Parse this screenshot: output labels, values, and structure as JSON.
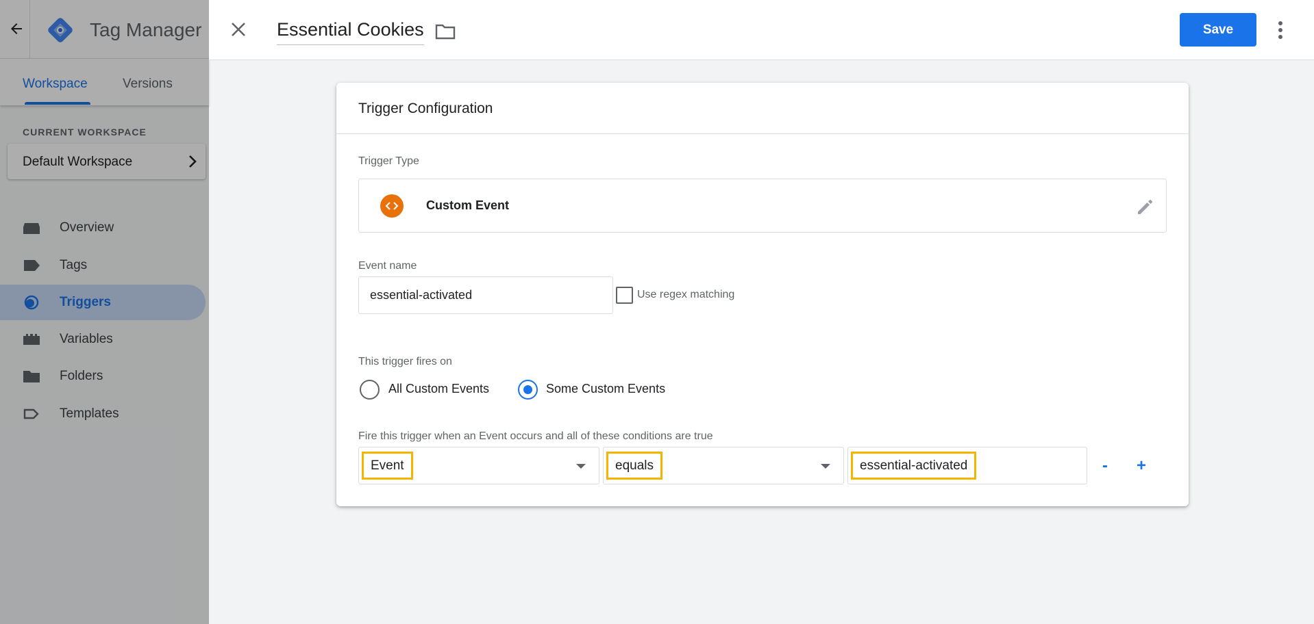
{
  "app": {
    "title": "Tag Manager",
    "brand_color": "#1a73e8",
    "icons": {
      "back": "arrow-left-icon",
      "logo": "tag-manager-logo"
    }
  },
  "workspace_tabs": [
    {
      "label": "Workspace",
      "active": true
    },
    {
      "label": "Versions",
      "active": false
    }
  ],
  "current_workspace": {
    "heading": "CURRENT WORKSPACE",
    "name": "Default Workspace"
  },
  "sidebar": {
    "items": [
      {
        "label": "Overview",
        "icon": "overview-icon",
        "active": false
      },
      {
        "label": "Tags",
        "icon": "tag-icon",
        "active": false
      },
      {
        "label": "Triggers",
        "icon": "trigger-icon",
        "active": true
      },
      {
        "label": "Variables",
        "icon": "variables-icon",
        "active": false
      },
      {
        "label": "Folders",
        "icon": "folder-icon",
        "active": false
      },
      {
        "label": "Templates",
        "icon": "template-icon",
        "active": false
      }
    ]
  },
  "editor": {
    "trigger_name": "Essential Cookies",
    "save_label": "Save",
    "icons": {
      "close": "close-icon",
      "folder": "folder-icon",
      "more": "more-vert-icon"
    }
  },
  "config": {
    "title": "Trigger Configuration",
    "trigger_type_label": "Trigger Type",
    "trigger_type": "Custom Event",
    "trigger_type_color": "#e8710a",
    "event_name_label": "Event name",
    "event_name": "essential-activated",
    "regex_label": "Use regex matching",
    "regex_checked": false,
    "fires_on_label": "This trigger fires on",
    "fires_on_options": [
      {
        "label": "All Custom Events",
        "selected": false
      },
      {
        "label": "Some Custom Events",
        "selected": true
      }
    ],
    "condition_label": "Fire this trigger when an Event occurs and all of these conditions are true",
    "condition": {
      "variable": "Event",
      "operator": "equals",
      "value": "essential-activated"
    },
    "remove_label": "-",
    "add_label": "+",
    "highlight_color": "#f4b400"
  }
}
